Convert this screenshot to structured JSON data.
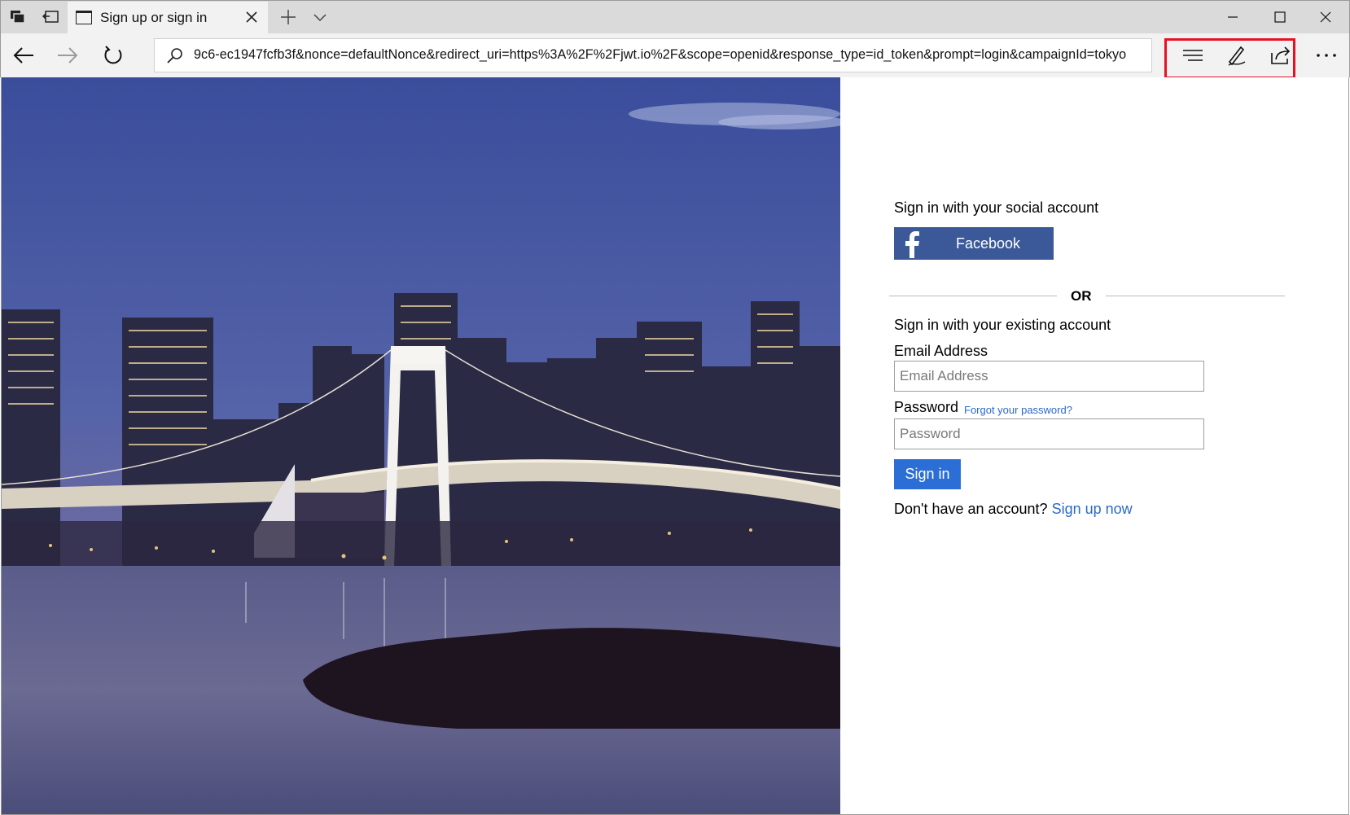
{
  "browser": {
    "tab_title": "Sign up or sign in",
    "address_url": "9c6-ec1947fcfb3f&nonce=defaultNonce&redirect_uri=https%3A%2F%2Fjwt.io%2F&scope=openid&response_type=id_token&prompt=login&campaignId=tokyo",
    "highlight_color": "#e81123"
  },
  "signin": {
    "social_heading": "Sign in with your social account",
    "facebook_label": "Facebook",
    "or_label": "OR",
    "existing_heading": "Sign in with your existing account",
    "email_label": "Email Address",
    "email_placeholder": "Email Address",
    "password_label": "Password",
    "forgot_link": "Forgot your password?",
    "password_placeholder": "Password",
    "signin_button": "Sign in",
    "no_account_text": "Don't have an account?",
    "signup_link": "Sign up now",
    "facebook_color": "#3b5998",
    "button_color": "#2b6fd6",
    "link_color": "#2a6ac9"
  }
}
